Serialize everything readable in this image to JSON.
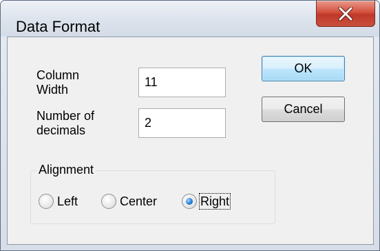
{
  "window": {
    "title": "Data Format",
    "close_icon": "close-icon"
  },
  "fields": {
    "column_width": {
      "label": "Column\nWidth",
      "value": "11"
    },
    "decimals": {
      "label": "Number of\ndecimals",
      "value": "2"
    }
  },
  "buttons": {
    "ok": "OK",
    "cancel": "Cancel"
  },
  "alignment": {
    "legend": "Alignment",
    "options": [
      {
        "label": "Left",
        "selected": false
      },
      {
        "label": "Center",
        "selected": false
      },
      {
        "label": "Right",
        "selected": true
      }
    ]
  },
  "colors": {
    "close_button": "#c8503c",
    "default_button_border": "#3c7fb1",
    "dialog_background": "#f0f0f0"
  }
}
